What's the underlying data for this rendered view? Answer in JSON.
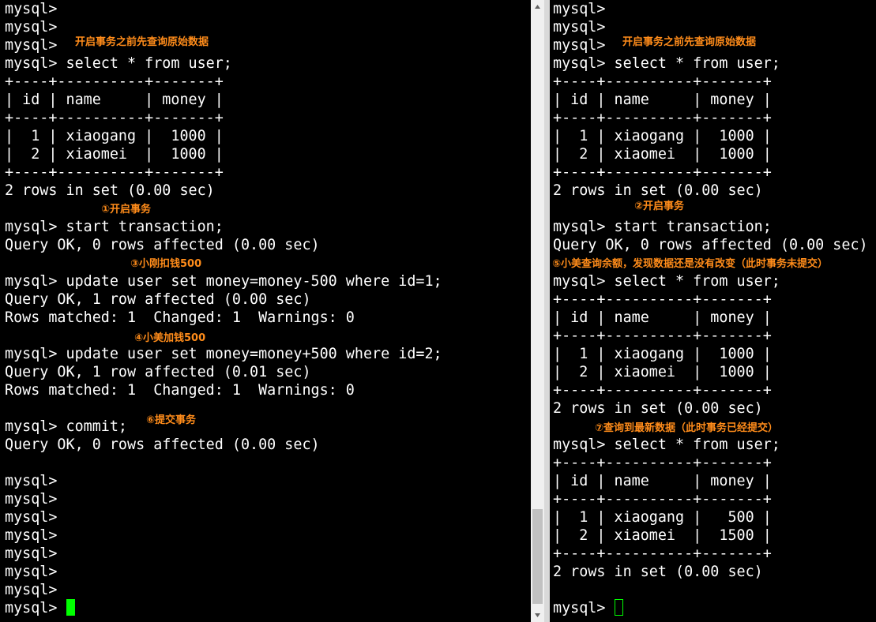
{
  "left_terminal": {
    "lines": [
      "mysql>",
      "mysql>",
      "mysql>",
      "mysql> select * from user;",
      "+----+----------+-------+",
      "| id | name     | money |",
      "+----+----------+-------+",
      "|  1 | xiaogang |  1000 |",
      "|  2 | xiaomei  |  1000 |",
      "+----+----------+-------+",
      "2 rows in set (0.00 sec)",
      "",
      "mysql> start transaction;",
      "Query OK, 0 rows affected (0.00 sec)",
      "",
      "mysql> update user set money=money-500 where id=1;",
      "Query OK, 1 row affected (0.00 sec)",
      "Rows matched: 1  Changed: 1  Warnings: 0",
      "",
      "mysql> update user set money=money+500 where id=2;",
      "Query OK, 1 row affected (0.01 sec)",
      "Rows matched: 1  Changed: 1  Warnings: 0",
      "",
      "mysql> commit;",
      "Query OK, 0 rows affected (0.00 sec)",
      "",
      "mysql>",
      "mysql>",
      "mysql>",
      "mysql>",
      "mysql>",
      "mysql>",
      "mysql>",
      "mysql> "
    ],
    "notes": [
      "开启事务之前先查询原始数据",
      "①开启事务",
      "③小刚扣钱500",
      "④小美加钱500",
      "⑥提交事务"
    ]
  },
  "right_terminal": {
    "lines": [
      "mysql>",
      "mysql>",
      "mysql>",
      "mysql> select * from user;",
      "+----+----------+-------+",
      "| id | name     | money |",
      "+----+----------+-------+",
      "|  1 | xiaogang |  1000 |",
      "|  2 | xiaomei  |  1000 |",
      "+----+----------+-------+",
      "2 rows in set (0.00 sec)",
      "",
      "mysql> start transaction;",
      "Query OK, 0 rows affected (0.00 sec)",
      "",
      "mysql> select * from user;",
      "+----+----------+-------+",
      "| id | name     | money |",
      "+----+----------+-------+",
      "|  1 | xiaogang |  1000 |",
      "|  2 | xiaomei  |  1000 |",
      "+----+----------+-------+",
      "2 rows in set (0.00 sec)",
      "",
      "mysql> select * from user;",
      "+----+----------+-------+",
      "| id | name     | money |",
      "+----+----------+-------+",
      "|  1 | xiaogang |   500 |",
      "|  2 | xiaomei  |  1500 |",
      "+----+----------+-------+",
      "2 rows in set (0.00 sec)",
      "",
      "mysql> "
    ],
    "notes": [
      "开启事务之前先查询原始数据",
      "②开启事务",
      "⑤小美查询余额，发现数据还是没有改变（此时事务未提交）",
      "⑦查询到最新数据（此时事务已经提交）"
    ]
  },
  "colors": {
    "background": "#000000",
    "text": "#ffffff",
    "annotation": "#ff8c1a",
    "cursor": "#00ff00"
  }
}
